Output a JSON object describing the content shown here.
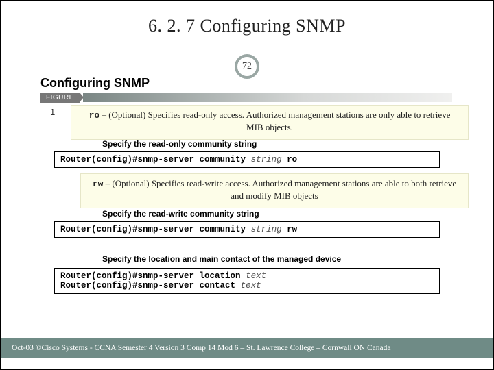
{
  "title": "6. 2. 7  Configuring SNMP",
  "slide_number": "72",
  "subheading": "Configuring SNMP",
  "figure_label": "FIGURE",
  "figure_number": "1",
  "notes": {
    "ro": {
      "keyword": "ro",
      "text": " – (Optional) Specifies read-only access. Authorized management stations are only able to retrieve MIB objects."
    },
    "rw": {
      "keyword": "rw",
      "text": " – (Optional) Specifies read-write access. Authorized management stations are able to both retrieve and modify MIB objects"
    }
  },
  "spec_headings": {
    "ro": "Specify the read-only community string",
    "rw": "Specify the read-write community string",
    "loc": "Specify the location and main contact of the managed device"
  },
  "commands": {
    "ro": {
      "prompt": "Router(config)#",
      "cmd": "snmp-server community ",
      "arg": "string",
      "suffix": " ro"
    },
    "rw": {
      "prompt": "Router(config)#",
      "cmd": "snmp-server community ",
      "arg": "string",
      "suffix": " rw"
    },
    "loc": {
      "prompt": "Router(config)#",
      "cmd": "snmp-server location ",
      "arg": "text"
    },
    "con": {
      "prompt": "Router(config)#",
      "cmd": "snmp-server contact ",
      "arg": "text"
    }
  },
  "footer": "Oct-03 ©Cisco Systems - CCNA Semester 4 Version 3 Comp 14 Mod 6 – St. Lawrence College – Cornwall ON Canada"
}
